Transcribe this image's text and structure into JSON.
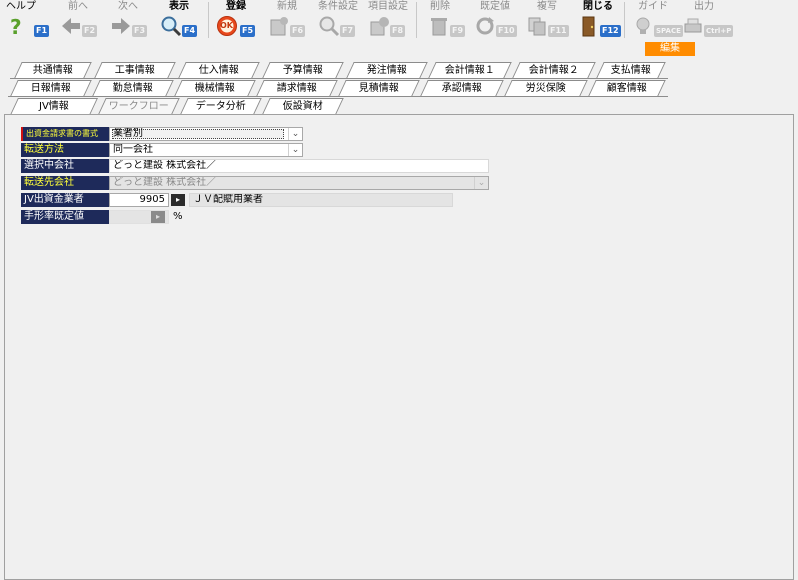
{
  "toolbar": {
    "help": {
      "label": "ヘルプ",
      "fkey": "F1"
    },
    "prev": {
      "label": "前へ",
      "fkey": "F2"
    },
    "next": {
      "label": "次へ",
      "fkey": "F3"
    },
    "display": {
      "label": "表示",
      "fkey": "F4"
    },
    "register": {
      "label": "登録",
      "fkey": "F5",
      "icon_text": "OK"
    },
    "new": {
      "label": "新規",
      "fkey": "F6"
    },
    "condition": {
      "label": "条件設定",
      "fkey": "F7"
    },
    "item_settings": {
      "label": "項目設定",
      "fkey": "F8"
    },
    "delete": {
      "label": "削除",
      "fkey": "F9"
    },
    "default": {
      "label": "既定値",
      "fkey": "F10"
    },
    "copy": {
      "label": "複写",
      "fkey": "F11"
    },
    "close": {
      "label": "閉じる",
      "fkey": "F12"
    },
    "guide": {
      "label": "ガイド",
      "fkey": "SPACE"
    },
    "output": {
      "label": "出力",
      "fkey": "Ctrl+P"
    },
    "edit_badge": "編集"
  },
  "tabs_row1": [
    "共通情報",
    "工事情報",
    "仕入情報",
    "予算情報",
    "発注情報",
    "会計情報１",
    "会計情報２",
    "支払情報"
  ],
  "tabs_row2": [
    "日報情報",
    "勤怠情報",
    "機械情報",
    "請求情報",
    "見積情報",
    "承認情報",
    "労災保険",
    "顧客情報"
  ],
  "tabs_row3": [
    {
      "label": "JV情報",
      "state": "active"
    },
    {
      "label": "ワークフロー",
      "state": "inactive"
    },
    {
      "label": "データ分析",
      "state": "normal"
    },
    {
      "label": "仮設資材",
      "state": "normal"
    }
  ],
  "form": {
    "invoice_format": {
      "label": "出資金請求書の書式",
      "value": "業者別"
    },
    "transfer_method": {
      "label": "転送方法",
      "value": "同一会社"
    },
    "selected_company": {
      "label": "選択中会社",
      "value": "どっと建設 株式会社／"
    },
    "destination_company": {
      "label": "転送先会社",
      "value": "どっと建設 株式会社／"
    },
    "jv_vendor": {
      "label": "JV出資金業者",
      "code": "9905",
      "name": "ＪＶ配賦用業者"
    },
    "bill_ratio": {
      "label": "手形率既定値",
      "unit": "%"
    }
  }
}
